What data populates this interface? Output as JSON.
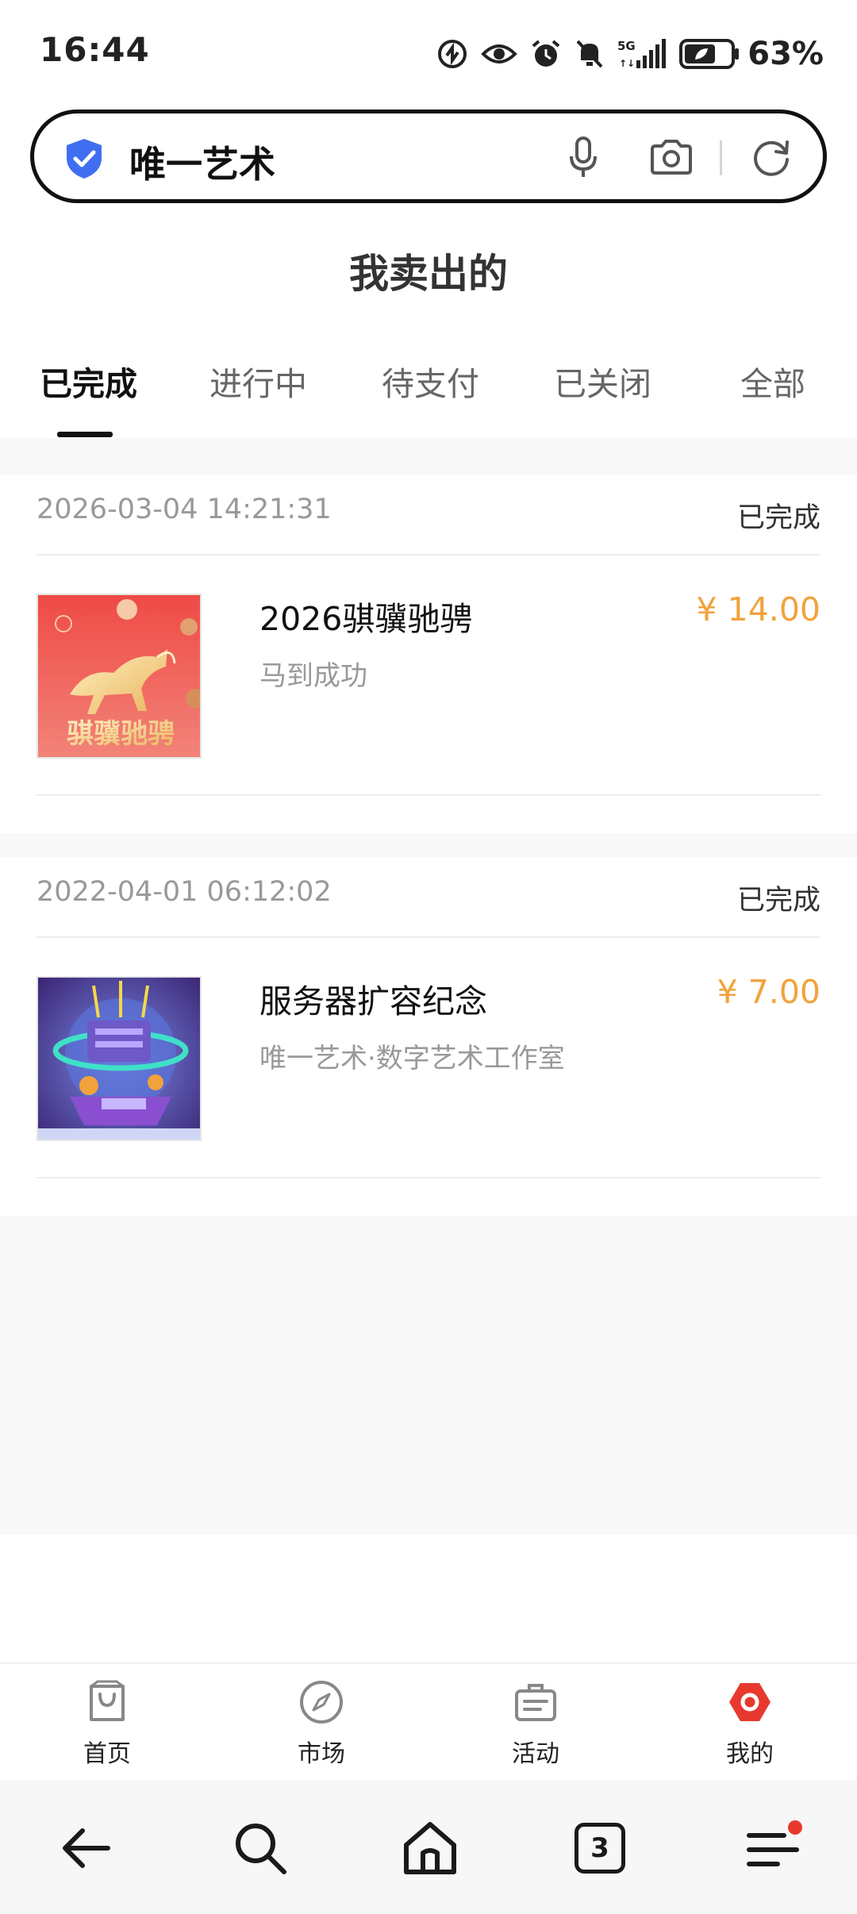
{
  "status_bar": {
    "time": "16:44",
    "battery_percent": "63%",
    "network": "5G",
    "icons": [
      "data-saver-icon",
      "eye-icon",
      "alarm-icon",
      "mute-icon",
      "signal-icon",
      "battery-icon"
    ]
  },
  "search": {
    "query": "唯一艺术",
    "icons": [
      "shield-check-icon",
      "mic-icon",
      "camera-icon",
      "refresh-icon"
    ]
  },
  "page": {
    "title": "我卖出的"
  },
  "tabs": [
    {
      "label": "已完成",
      "active": true
    },
    {
      "label": "进行中",
      "active": false
    },
    {
      "label": "待支付",
      "active": false
    },
    {
      "label": "已关闭",
      "active": false
    },
    {
      "label": "全部",
      "active": false
    }
  ],
  "orders": [
    {
      "date": "2026-03-04 14:21:31",
      "status": "已完成",
      "name": "2026骐骥驰骋",
      "subtitle": "马到成功",
      "price": "¥ 14.00",
      "thumbnail": {
        "icon": "golden-horse-artwork",
        "text": "骐骥驰骋"
      }
    },
    {
      "date": "2022-04-01 06:12:02",
      "status": "已完成",
      "name": "服务器扩容纪念",
      "subtitle": "唯一艺术·数字艺术工作室",
      "price": "¥ 7.00",
      "thumbnail": {
        "icon": "server-artwork"
      }
    }
  ],
  "bottom_nav": [
    {
      "label": "首页",
      "icon": "shopping-bag-icon",
      "active": false
    },
    {
      "label": "市场",
      "icon": "compass-icon",
      "active": false
    },
    {
      "label": "活动",
      "icon": "briefcase-icon",
      "active": false
    },
    {
      "label": "我的",
      "icon": "profile-hexagon-icon",
      "active": true
    }
  ],
  "system_nav": {
    "tab_count": "3",
    "icons": [
      "back-arrow-icon",
      "search-icon",
      "home-icon",
      "tabs-icon",
      "menu-icon"
    ]
  },
  "colors": {
    "price": "#f2a23c",
    "accent_red": "#e8392e",
    "shield_blue": "#3f6ff0"
  }
}
